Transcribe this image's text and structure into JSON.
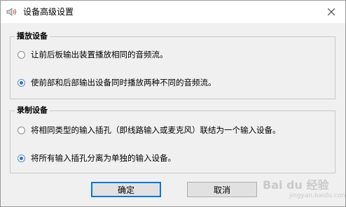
{
  "window": {
    "title": "设备高级设置",
    "icon": "speaker-icon"
  },
  "playback_group": {
    "legend": "播放设备",
    "options": [
      {
        "label": "让前后板输出装置播放相同的音频流。",
        "checked": false
      },
      {
        "label": "使前部和后部输出设备同时播放两种不同的音频流。",
        "checked": true
      }
    ]
  },
  "record_group": {
    "legend": "录制设备",
    "options": [
      {
        "label": "将相同类型的输入插孔（即线路输入或麦克风）联结为一个输入设备。",
        "checked": false
      },
      {
        "label": "将所有输入插孔分离为单独的输入设备。",
        "checked": true
      }
    ]
  },
  "buttons": {
    "ok": "确定",
    "cancel": "取消"
  },
  "watermark": {
    "main": "Bai du 经验",
    "sub": "jingyan.baidu.com"
  },
  "colors": {
    "accent": "#0078d7",
    "radio_dot": "#3b6fb6"
  }
}
